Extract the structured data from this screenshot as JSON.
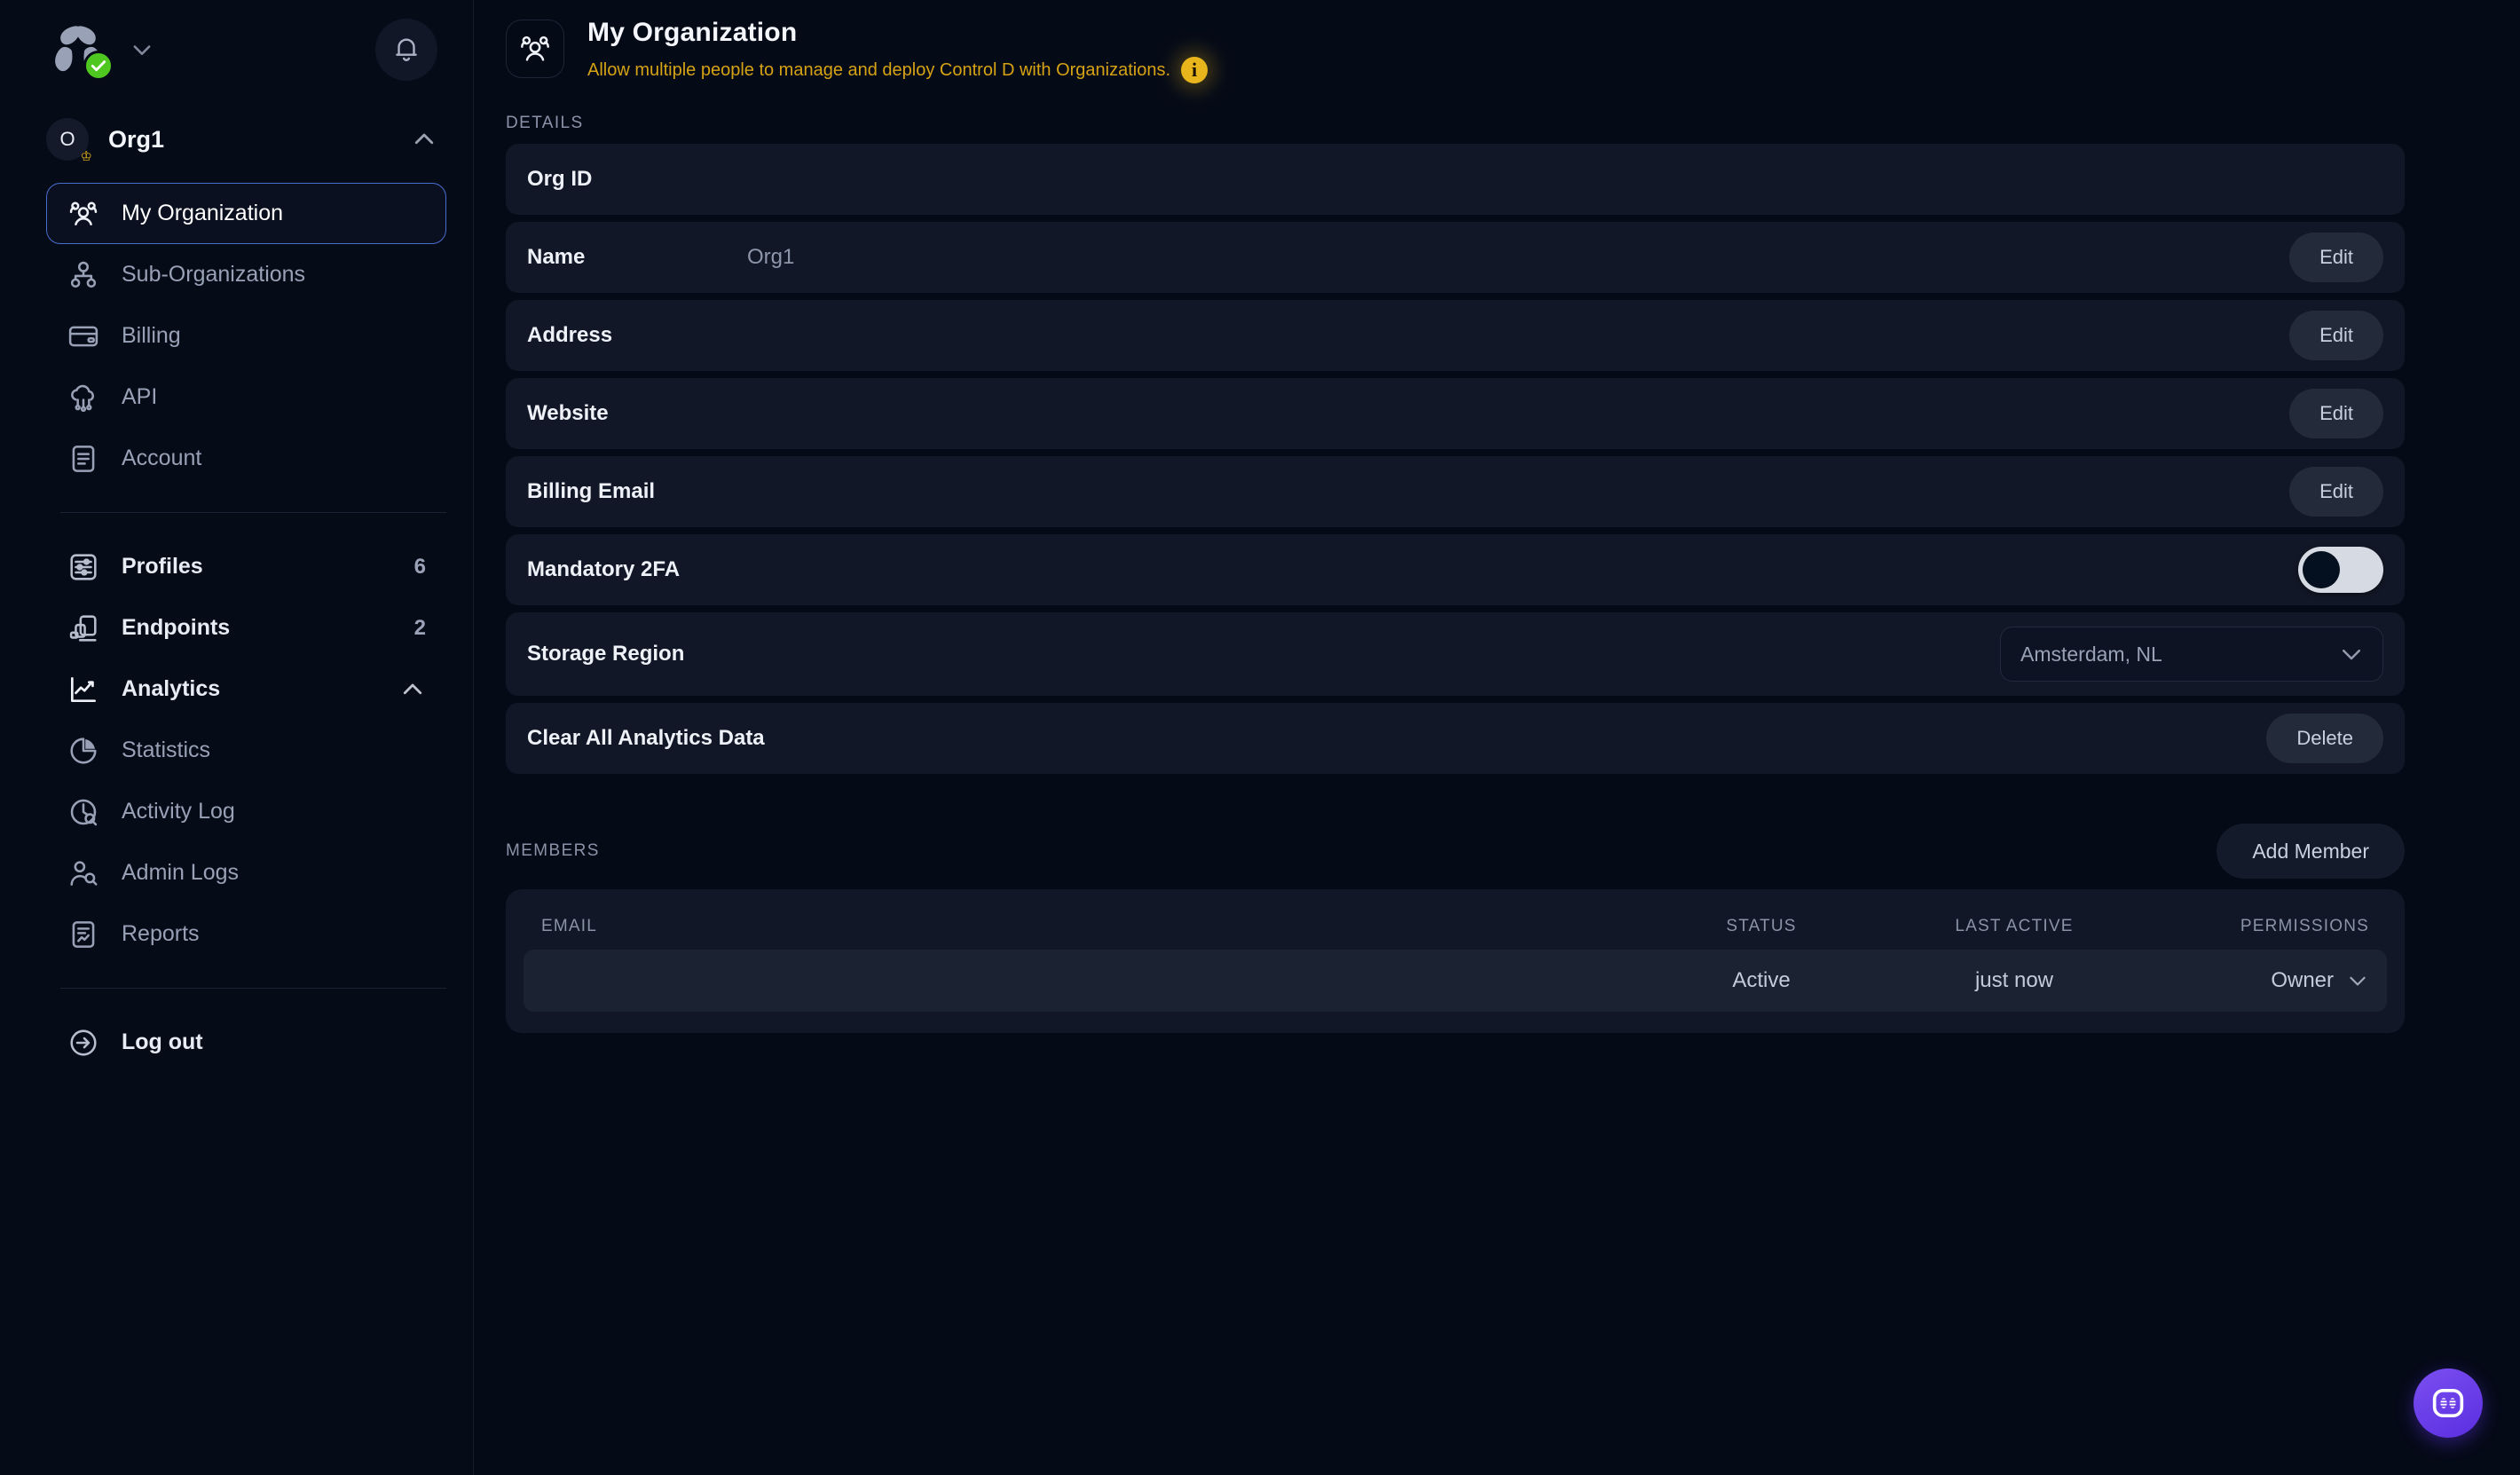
{
  "sidebar": {
    "brand": {
      "logo_name": "control-d-logo",
      "status": "verified"
    },
    "notifications_icon": "bell-icon",
    "org_switcher": {
      "avatar_letter": "O",
      "name": "Org1",
      "expanded": true
    },
    "nav_primary": [
      {
        "label": "My Organization",
        "icon": "organization-icon",
        "selected": true
      },
      {
        "label": "Sub-Organizations",
        "icon": "sub-organizations-icon",
        "selected": false
      },
      {
        "label": "Billing",
        "icon": "credit-card-icon",
        "selected": false
      },
      {
        "label": "API",
        "icon": "api-cloud-icon",
        "selected": false
      },
      {
        "label": "Account",
        "icon": "account-document-icon",
        "selected": false
      }
    ],
    "nav_secondary": [
      {
        "label": "Profiles",
        "icon": "sliders-icon",
        "count": "6"
      },
      {
        "label": "Endpoints",
        "icon": "devices-icon",
        "count": "2"
      },
      {
        "label": "Analytics",
        "icon": "line-chart-icon",
        "count": "",
        "expanded": true
      }
    ],
    "nav_analytics": [
      {
        "label": "Statistics",
        "icon": "pie-chart-icon"
      },
      {
        "label": "Activity Log",
        "icon": "clock-search-icon"
      },
      {
        "label": "Admin Logs",
        "icon": "user-search-icon"
      },
      {
        "label": "Reports",
        "icon": "report-document-icon"
      }
    ],
    "logout": {
      "label": "Log out",
      "icon": "logout-icon"
    }
  },
  "header": {
    "icon": "organization-icon",
    "title": "My Organization",
    "subtitle": "Allow multiple people to manage and deploy Control D with Organizations.",
    "info_glyph": "i",
    "subtitle_color": "#d6a314"
  },
  "details": {
    "section_label": "DETAILS",
    "rows": [
      {
        "label": "Org ID",
        "value": "",
        "action": ""
      },
      {
        "label": "Name",
        "value": "Org1",
        "action": "Edit"
      },
      {
        "label": "Address",
        "value": "",
        "action": "Edit"
      },
      {
        "label": "Website",
        "value": "",
        "action": "Edit"
      },
      {
        "label": "Billing Email",
        "value": "",
        "action": "Edit"
      }
    ],
    "mandatory_2fa": {
      "label": "Mandatory 2FA",
      "enabled": false
    },
    "storage_region": {
      "label": "Storage Region",
      "value": "Amsterdam, NL"
    },
    "clear_analytics": {
      "label": "Clear All Analytics Data",
      "action": "Delete"
    }
  },
  "members": {
    "section_label": "MEMBERS",
    "add_button": "Add Member",
    "columns": [
      "EMAIL",
      "STATUS",
      "LAST ACTIVE",
      "PERMISSIONS"
    ],
    "rows": [
      {
        "email": "",
        "status": "Active",
        "last_active": "just now",
        "permissions": "Owner"
      }
    ]
  },
  "fab": {
    "icon": "chat-bot-icon",
    "color": "#5b2ee0"
  }
}
